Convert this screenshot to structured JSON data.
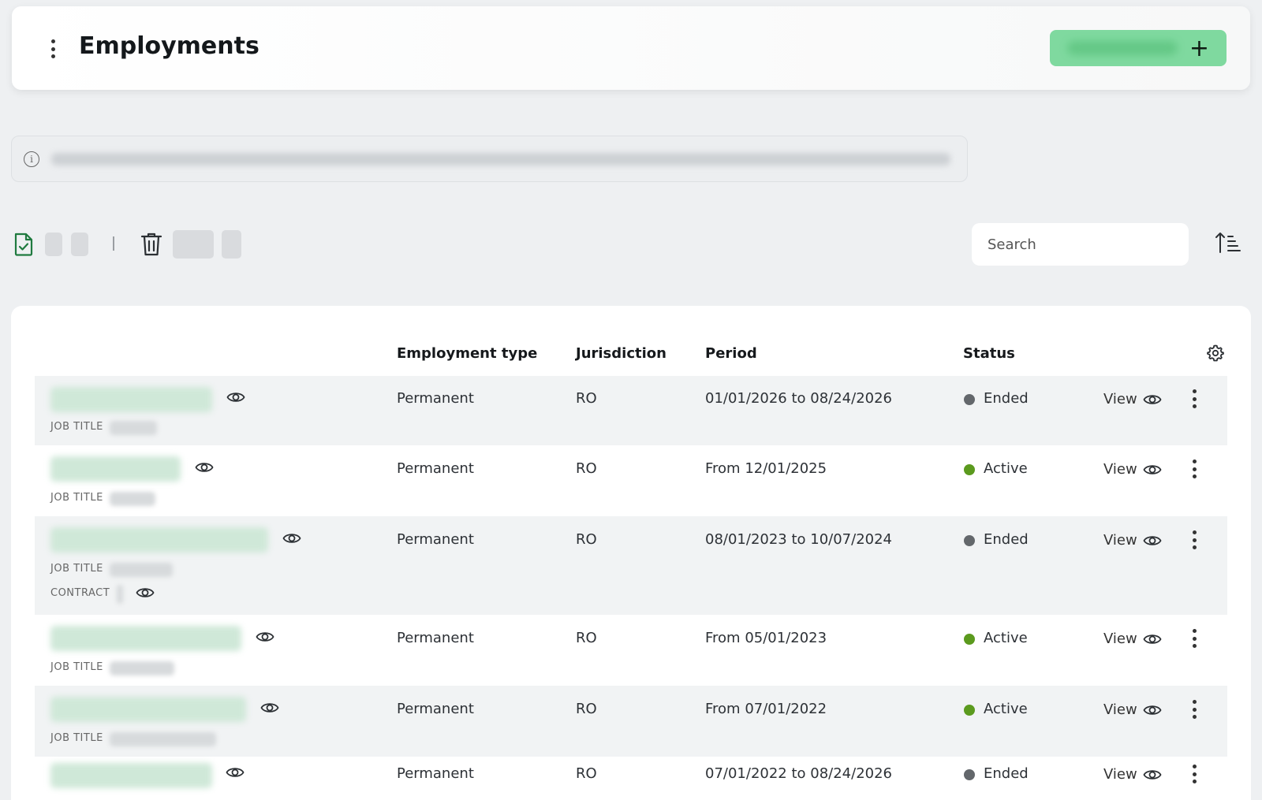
{
  "header": {
    "title": "Employments"
  },
  "search": {
    "placeholder": "Search"
  },
  "table": {
    "columns": {
      "employment_type": "Employment type",
      "jurisdiction": "Jurisdiction",
      "period": "Period",
      "status": "Status"
    },
    "labels": {
      "job_title": "JOB TITLE",
      "contract": "CONTRACT",
      "view": "View"
    },
    "rows": [
      {
        "type": "Permanent",
        "jurisdiction": "RO",
        "period": "01/01/2026 to 08/24/2026",
        "status": "Ended"
      },
      {
        "type": "Permanent",
        "jurisdiction": "RO",
        "period": "From 12/01/2025",
        "status": "Active"
      },
      {
        "type": "Permanent",
        "jurisdiction": "RO",
        "period": "08/01/2023 to 10/07/2024",
        "status": "Ended"
      },
      {
        "type": "Permanent",
        "jurisdiction": "RO",
        "period": "From 05/01/2023",
        "status": "Active"
      },
      {
        "type": "Permanent",
        "jurisdiction": "RO",
        "period": "From 07/01/2022",
        "status": "Active"
      },
      {
        "type": "Permanent",
        "jurisdiction": "RO",
        "period": "07/01/2022 to 08/24/2026",
        "status": "Ended"
      }
    ]
  },
  "colors": {
    "accent": "#7fd99f",
    "active": "#5b9a1e",
    "ended": "#63676b",
    "toolbar_green": "#1f7a3f"
  },
  "icons": [
    "kebab-icon",
    "plus-icon",
    "info-icon",
    "document-check-icon",
    "trash-icon",
    "sort-icon",
    "gear-icon",
    "eye-icon"
  ]
}
